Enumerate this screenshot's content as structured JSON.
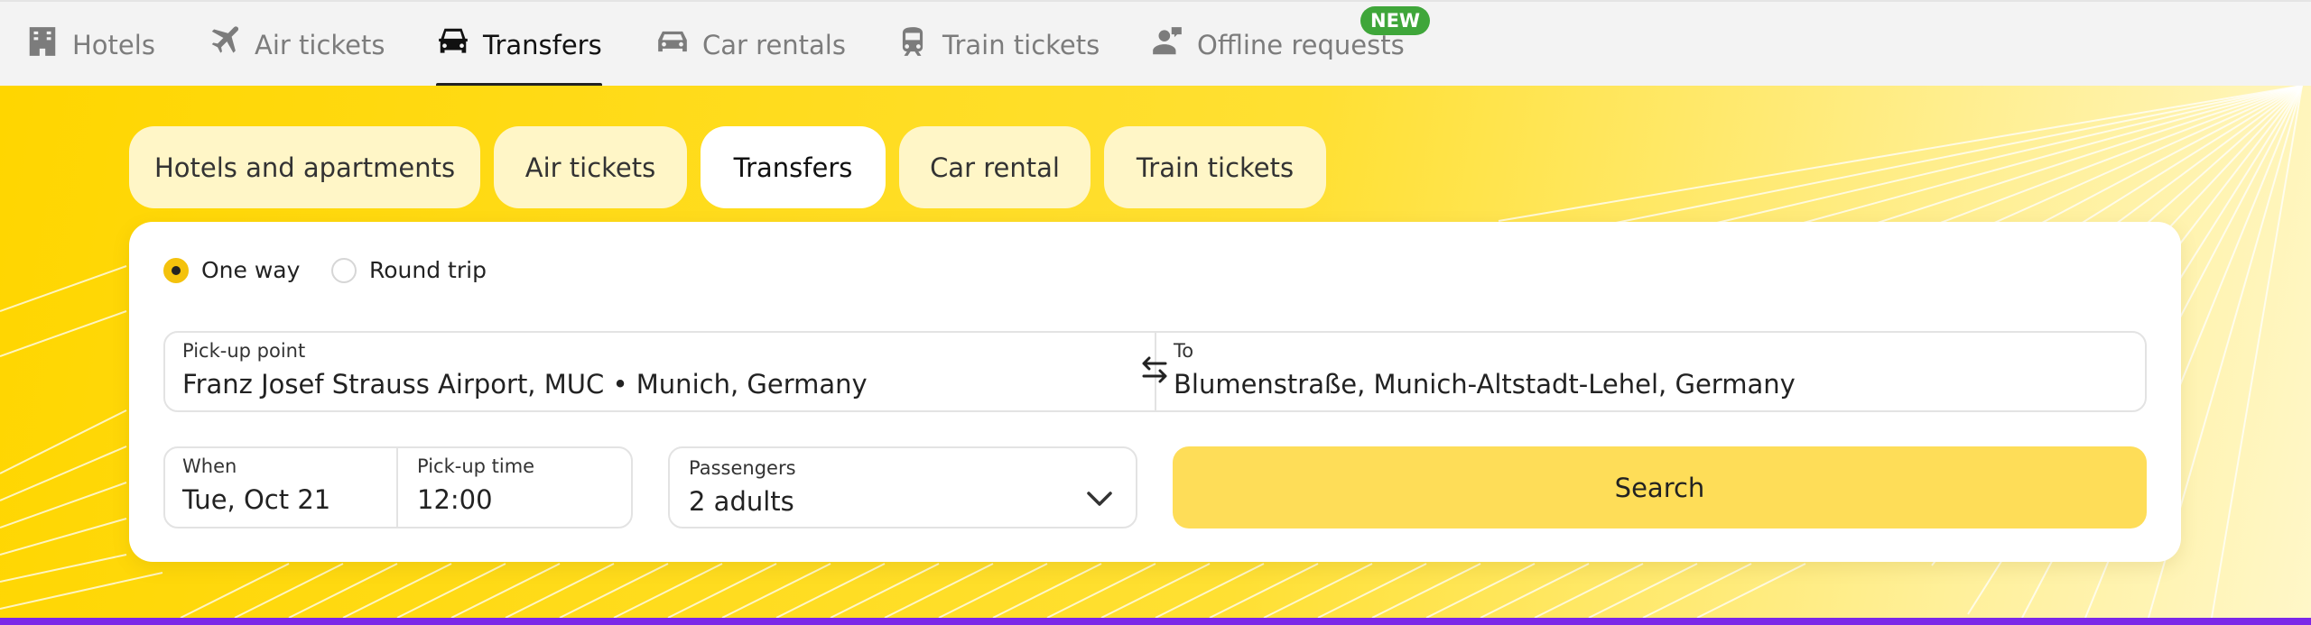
{
  "topnav": {
    "items": [
      {
        "label": "Hotels",
        "icon": "hotel-icon"
      },
      {
        "label": "Air tickets",
        "icon": "plane-icon"
      },
      {
        "label": "Transfers",
        "icon": "car-front-icon"
      },
      {
        "label": "Car rentals",
        "icon": "car-icon"
      },
      {
        "label": "Train tickets",
        "icon": "train-icon"
      },
      {
        "label": "Offline requests",
        "icon": "person-chat-icon"
      }
    ],
    "active": "Transfers",
    "badge": "NEW"
  },
  "tabs": [
    {
      "label": "Hotels and apartments"
    },
    {
      "label": "Air tickets"
    },
    {
      "label": "Transfers"
    },
    {
      "label": "Car rental"
    },
    {
      "label": "Train tickets"
    }
  ],
  "active_tab": "Transfers",
  "form": {
    "trip_type": {
      "one_way": "One way",
      "round_trip": "Round trip",
      "selected": "One way"
    },
    "pickup": {
      "label": "Pick-up point",
      "value": "Franz Josef Strauss Airport, MUC • Munich, Germany"
    },
    "to": {
      "label": "To",
      "value": "Blumenstraße, Munich-Altstadt-Lehel, Germany"
    },
    "when": {
      "label": "When",
      "value": "Tue, Oct 21"
    },
    "time": {
      "label": "Pick-up time",
      "value": "12:00"
    },
    "passengers": {
      "label": "Passengers",
      "value": "2 adults"
    },
    "search": "Search"
  },
  "colors": {
    "accent_yellow": "#ffd600",
    "button_yellow": "#fedd58",
    "radio_checked": "#f4c20d",
    "badge_green": "#3fa63a",
    "bottom_bar": "#7b27e8"
  }
}
